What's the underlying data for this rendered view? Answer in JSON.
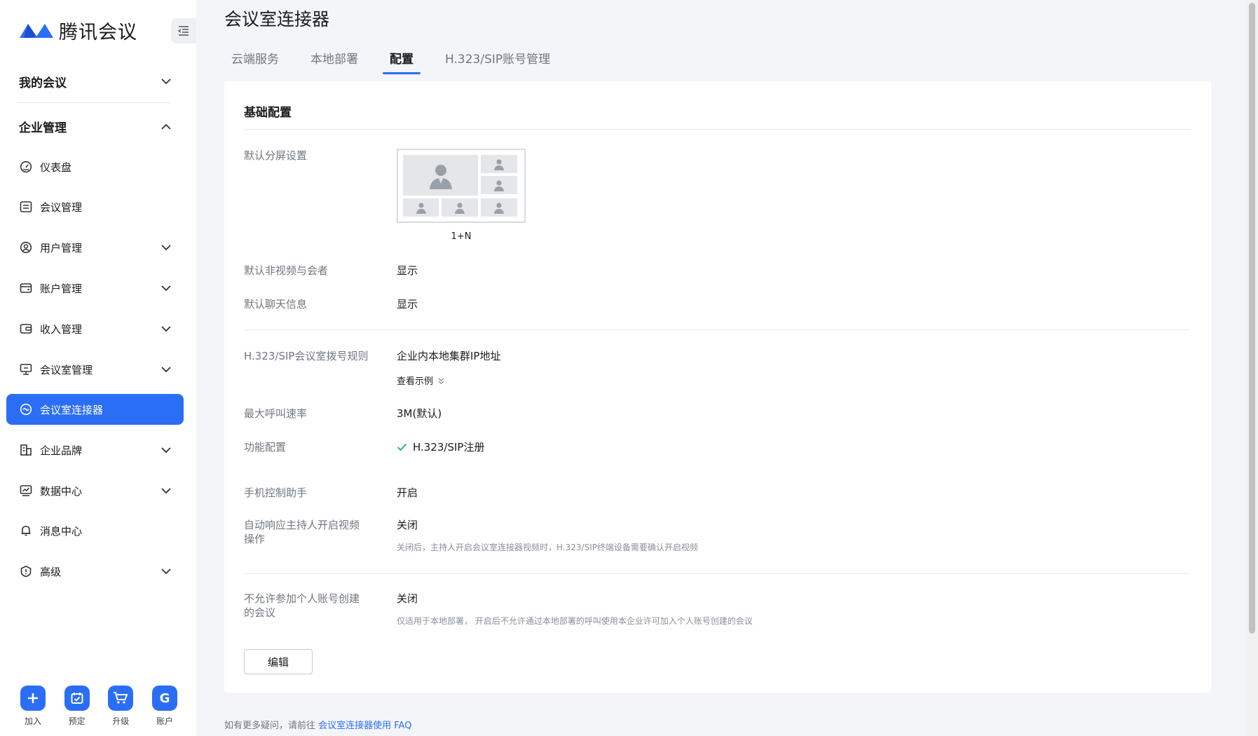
{
  "app": {
    "logo_text": "腾讯会议",
    "brand_color": "#2b6ef6"
  },
  "sidebar": {
    "groups": [
      {
        "label": "我的会议",
        "expanded": false
      },
      {
        "label": "企业管理",
        "expanded": true
      }
    ],
    "items": [
      {
        "label": "仪表盘",
        "icon": "gauge-icon",
        "has_chevron": false
      },
      {
        "label": "会议管理",
        "icon": "list-icon",
        "has_chevron": false
      },
      {
        "label": "用户管理",
        "icon": "user-icon",
        "has_chevron": true
      },
      {
        "label": "账户管理",
        "icon": "wallet-icon",
        "has_chevron": true
      },
      {
        "label": "收入管理",
        "icon": "income-icon",
        "has_chevron": true
      },
      {
        "label": "会议室管理",
        "icon": "room-icon",
        "has_chevron": true
      },
      {
        "label": "会议室连接器",
        "icon": "connector-icon",
        "has_chevron": false,
        "active": true
      },
      {
        "label": "企业品牌",
        "icon": "brand-icon",
        "has_chevron": true
      },
      {
        "label": "数据中心",
        "icon": "chart-icon",
        "has_chevron": true
      },
      {
        "label": "消息中心",
        "icon": "bell-icon",
        "has_chevron": false
      },
      {
        "label": "高级",
        "icon": "info-icon",
        "has_chevron": true
      }
    ],
    "actions": [
      {
        "label": "加入",
        "glyph": "+"
      },
      {
        "label": "预定",
        "glyph": ""
      },
      {
        "label": "升级",
        "glyph": ""
      },
      {
        "label": "账户",
        "glyph": "G"
      }
    ]
  },
  "page": {
    "title": "会议室连接器",
    "tabs": [
      {
        "label": "云端服务",
        "active": false
      },
      {
        "label": "本地部署",
        "active": false
      },
      {
        "label": "配置",
        "active": true
      },
      {
        "label": "H.323/SIP账号管理",
        "active": false
      }
    ]
  },
  "config": {
    "section_title": "基础配置",
    "split_screen": {
      "label": "默认分屏设置",
      "layout": "1+N"
    },
    "non_video": {
      "label": "默认非视频与会者",
      "value": "显示"
    },
    "chat": {
      "label": "默认聊天信息",
      "value": "显示"
    },
    "dial_rule": {
      "label": "H.323/SIP会议室拨号规则",
      "value": "企业内本地集群IP地址",
      "link": "查看示例"
    },
    "max_rate": {
      "label": "最大呼叫速率",
      "value": "3M(默认)"
    },
    "features": {
      "label": "功能配置",
      "value": "H.323/SIP注册"
    },
    "mobile_assistant": {
      "label": "手机控制助手",
      "value": "开启"
    },
    "auto_respond": {
      "label_line1": "自动响应主持人开启视频",
      "label_line2": "操作",
      "value": "关闭",
      "hint": "关闭后，主持人开启会议室连接器视频时，H.323/SIP终端设备需要确认开启视频"
    },
    "disallow_personal": {
      "label_line1": "不允许参加个人账号创建",
      "label_line2": "的会议",
      "value": "关闭",
      "hint": "仅适用于本地部署， 开启后不允许通过本地部署的呼叫使用本企业许可加入个人账号创建的会议"
    },
    "edit_label": "编辑"
  },
  "footer": {
    "prefix": "如有更多疑问，请前往 ",
    "link": "会议室连接器使用 FAQ"
  }
}
